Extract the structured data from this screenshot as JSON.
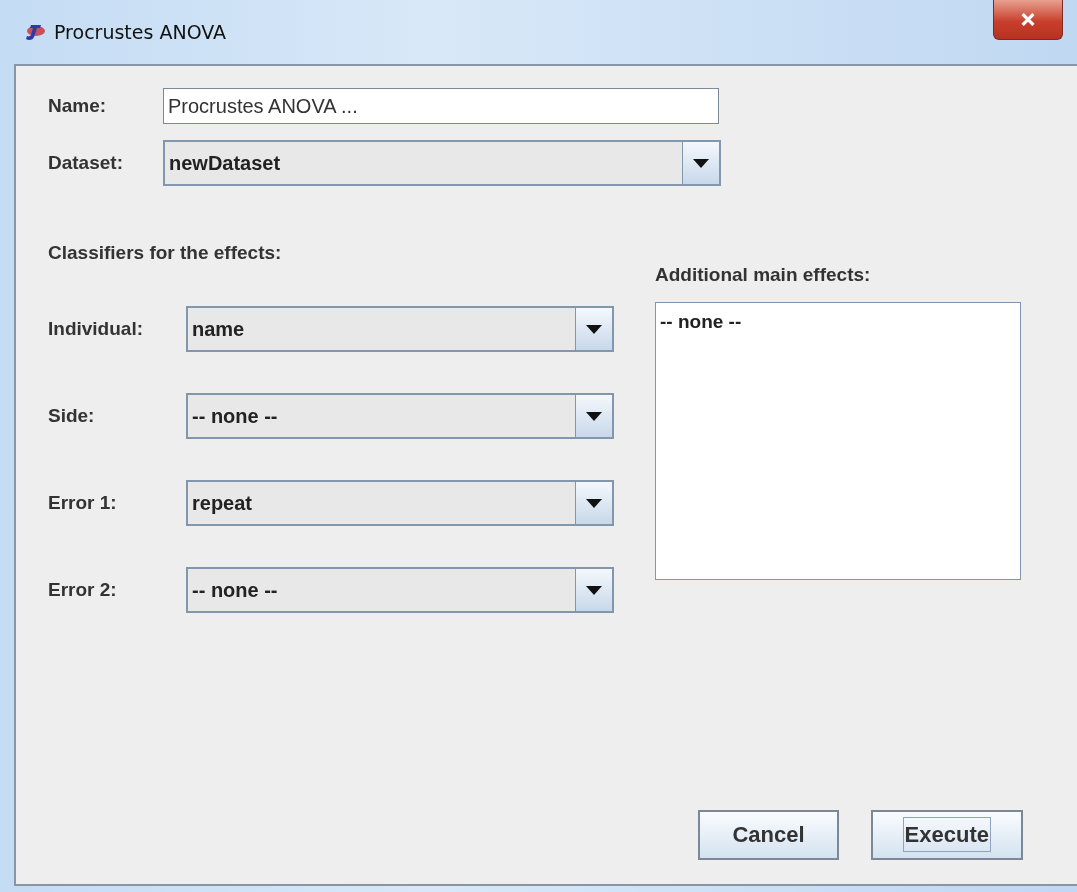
{
  "window": {
    "title": "Procrustes ANOVA"
  },
  "name_field": {
    "label": "Name:",
    "value": "Procrustes ANOVA ..."
  },
  "dataset": {
    "label": "Dataset:",
    "value": "newDataset"
  },
  "classifiers": {
    "heading": "Classifiers for the effects:",
    "rows": [
      {
        "label": "Individual:",
        "value": "name"
      },
      {
        "label": "Side:",
        "value": "-- none --"
      },
      {
        "label": "Error 1:",
        "value": "repeat"
      },
      {
        "label": "Error 2:",
        "value": "-- none --"
      }
    ]
  },
  "main_effects": {
    "label": "Additional main effects:",
    "items": [
      {
        "label": "-- none --",
        "selected": false
      }
    ]
  },
  "buttons": [
    {
      "label": "Cancel",
      "focused": false
    },
    {
      "label": "Execute",
      "focused": true
    }
  ]
}
